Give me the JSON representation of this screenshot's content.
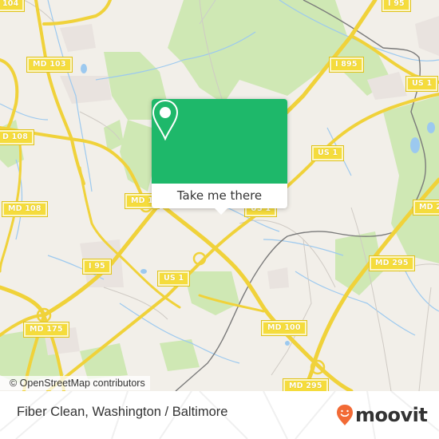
{
  "map": {
    "road_labels": [
      {
        "id": "md104",
        "text": "104"
      },
      {
        "id": "md103",
        "text": "MD 103"
      },
      {
        "id": "md108_left",
        "text": "D 108"
      },
      {
        "id": "md108",
        "text": "MD 108"
      },
      {
        "id": "md1x",
        "text": "MD 1"
      },
      {
        "id": "i95",
        "text": "I 95"
      },
      {
        "id": "us1_mid",
        "text": "US 1"
      },
      {
        "id": "md175",
        "text": "MD 175"
      },
      {
        "id": "md100",
        "text": "MD 100"
      },
      {
        "id": "md295",
        "text": "MD 295"
      },
      {
        "id": "md295_bottom",
        "text": "MD 295"
      },
      {
        "id": "md2x_right",
        "text": "MD 2"
      },
      {
        "id": "i95_top",
        "text": "I 95"
      },
      {
        "id": "i895",
        "text": "I 895"
      },
      {
        "id": "us1_top",
        "text": "US 1"
      },
      {
        "id": "us1_right",
        "text": "US 1"
      },
      {
        "id": "us1_popup",
        "text": "US 1"
      }
    ],
    "colors": {
      "land": "#f2efe9",
      "park": "#c8e6a8",
      "water": "#9cc9ef",
      "road": "#f5dc3c",
      "rail": "#707070",
      "residential": "#e8dede"
    },
    "attribution": "© OpenStreetMap contributors"
  },
  "popup": {
    "icon": "map-pin-icon",
    "button_label": "Take me there",
    "color": "#1eb86a"
  },
  "footer": {
    "title": "Fiber Clean, Washington / Baltimore",
    "brand": "moovit",
    "brand_color": "#f26a35"
  }
}
